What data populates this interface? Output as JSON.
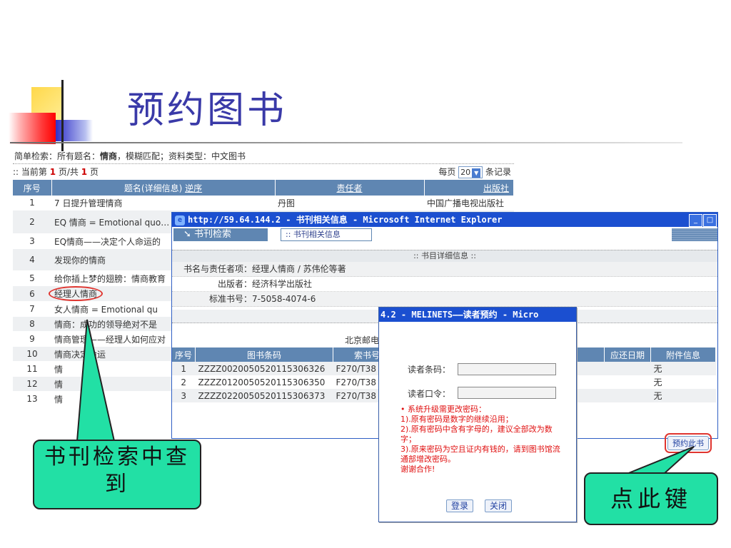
{
  "slide": {
    "title": "预约图书"
  },
  "search": {
    "criteria_prefix": "简单检索：所有题名：",
    "criteria_bold": "情商",
    "criteria_suffix": "，模糊匹配；资料类型：中文图书",
    "pager_prefix": ":: 当前第 ",
    "page_current": "1",
    "pager_middle": " 页/共 ",
    "page_total": "1",
    "pager_suffix": " 页",
    "per_page_label": "每页",
    "per_page_value": "20",
    "per_page_suffix": "条记录",
    "columns": {
      "no": "序号",
      "title": "题名(详细信息)",
      "sort": "逆序",
      "author": "责任者",
      "publisher": "出版社"
    },
    "rows": [
      {
        "no": "1",
        "title": "7 日提升管理情商",
        "author": "丹图",
        "publisher": "中国广播电视出版社"
      },
      {
        "no": "2",
        "title": "EQ 情商 = Emotional quo… 超级影响力"
      },
      {
        "no": "3",
        "title": "EQ情商——决定个人命运的"
      },
      {
        "no": "4",
        "title": "发现你的情商"
      },
      {
        "no": "5",
        "title": "给你插上梦的翅膀：情商教育"
      },
      {
        "no": "6",
        "title": "经理人情商"
      },
      {
        "no": "7",
        "title": "女人情商 = Emotional qu"
      },
      {
        "no": "8",
        "title": "情商：成功的领导绝对不是"
      },
      {
        "no": "9",
        "title": "情商管理——经理人如何应对"
      },
      {
        "no": "10",
        "title": "情商决定命运"
      },
      {
        "no": "11",
        "title": "情"
      },
      {
        "no": "12",
        "title": "情"
      },
      {
        "no": "13",
        "title": "情"
      }
    ]
  },
  "ie_window": {
    "title": "http://59.64.144.2 - 书刊相关信息 - Microsoft Internet Explorer",
    "tab_search": "书刊检索",
    "tab_info": ":: 书刊相关信息",
    "detail_header": ":: 书目详细信息 ::",
    "fields": [
      {
        "key": "书名与责任者项",
        "value": "：经理人情商 / 苏伟伦等著"
      },
      {
        "key": "出版者",
        "value": "：经济科学出版社"
      },
      {
        "key": "标准书号",
        "value": "：7-5058-4074-6"
      }
    ],
    "library": "北京邮电",
    "copy_columns": {
      "no": "序号",
      "barcode": "图书条码",
      "callno": "索书号",
      "due": "应还日期",
      "attach": "附件信息"
    },
    "copies": [
      {
        "no": "1",
        "barcode": "ZZZZ0020050520115306326",
        "callno": "F270/T38",
        "attach": "无"
      },
      {
        "no": "2",
        "barcode": "ZZZZ0120050520115306350",
        "callno": "F270/T38",
        "attach": "无"
      },
      {
        "no": "3",
        "barcode": "ZZZZ0220050520115306373",
        "callno": "F270/T38",
        "attach": "无"
      }
    ],
    "reserve_button": "预约此书"
  },
  "modal": {
    "title": "4.2 - MELINETS——读者预约 - Micro",
    "barcode_label": "读者条码：",
    "password_label": "读者口令：",
    "notice": [
      "• 系统升级需更改密码：",
      "1).原有密码是数字的继续沿用；",
      "2).原有密码中含有字母的，建议全部改为数字；",
      "3).原来密码为空且证内有钱的，请到图书馆流通部增改密码。",
      "谢谢合作!"
    ],
    "login_button": "登录",
    "close_button": "关闭"
  },
  "callouts": {
    "left": "书刊检索中查到",
    "right": "点此键"
  },
  "colors": {
    "title": "#3a3aa8",
    "header": "#5f86b2",
    "titlebar": "#1b4fd0",
    "callout": "#22e0a5",
    "alert": "#e01010"
  }
}
